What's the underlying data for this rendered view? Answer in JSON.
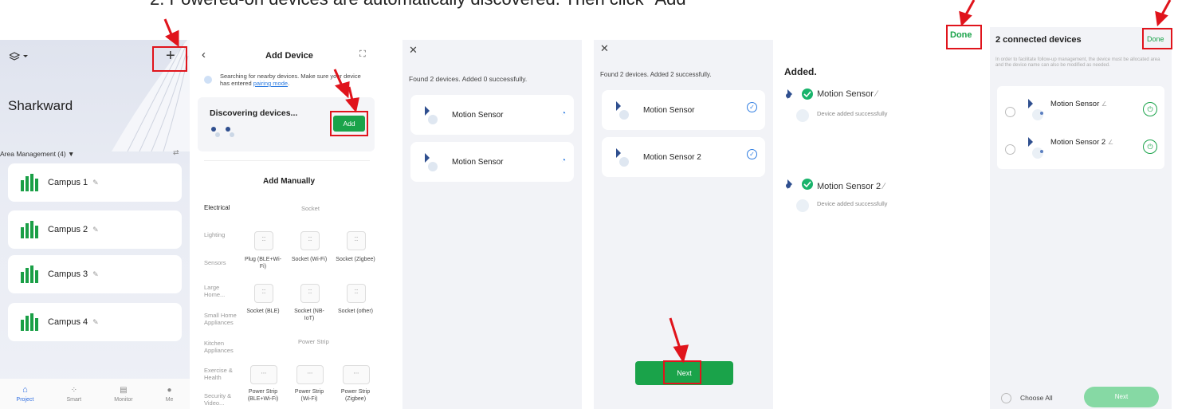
{
  "heading": "2. Powered-on devices are automatically discovered. Then click \"Add\"",
  "colors": {
    "accent": "#1aa34a",
    "highlight": "#e0141c",
    "link": "#2f7de1"
  },
  "panel1": {
    "project_name": "Sharkward",
    "area_label": "Area Management (4) ▼",
    "campuses": [
      "Campus 1",
      "Campus 2",
      "Campus 3",
      "Campus 4"
    ],
    "tabs": [
      "Project",
      "Smart",
      "Monitor",
      "Me"
    ],
    "plus": "+"
  },
  "panel2": {
    "title": "Add Device",
    "search_text_1": "Searching for nearby devices. Make sure your device",
    "search_text_2": "has entered ",
    "search_link": "pairing mode",
    "search_text_end": ".",
    "discovering": "Discovering devices...",
    "add_button": "Add",
    "add_manually": "Add Manually",
    "categories": [
      "Electrical",
      "Lighting",
      "Sensors",
      "Large Home...",
      "Small Home Appliances",
      "Kitchen Appliances",
      "Exercise & Health",
      "Security & Video..."
    ],
    "group_socket": "Socket",
    "group_strip": "Power Strip",
    "sockets_row1": [
      "Plug (BLE+Wi-Fi)",
      "Socket (Wi-Fi)",
      "Socket (Zigbee)"
    ],
    "sockets_row2": [
      "Socket (BLE)",
      "Socket (NB-IoT)",
      "Socket (other)"
    ],
    "strips": [
      "Power Strip (BLE+Wi-Fi)",
      "Power Strip (Wi-Fi)",
      "Power Strip (Zigbee)"
    ]
  },
  "panel3": {
    "close": "✕",
    "found_text": "Found 2 devices. Added 0 successfully.",
    "devices": [
      "Motion Sensor",
      "Motion Sensor"
    ]
  },
  "panel4": {
    "close": "✕",
    "found_text": "Found 2 devices. Added 2 successfully.",
    "devices": [
      "Motion Sensor",
      "Motion Sensor 2"
    ],
    "next_button": "Next"
  },
  "panel5": {
    "title": "Added.",
    "devices": [
      {
        "name": "Motion Sensor",
        "status": "Device added successfully"
      },
      {
        "name": "Motion Sensor 2",
        "status": "Device added successfully"
      }
    ],
    "done_button": "Done"
  },
  "panel6": {
    "title": "2 connected devices",
    "done_button": "Done",
    "info": "In order to facilitate follow-up management, the device must be allocated area and the device name can also be modified as needed.",
    "devices": [
      "Motion Sensor",
      "Motion Sensor 2"
    ],
    "choose_all": "Choose All",
    "next_button": "Next"
  }
}
